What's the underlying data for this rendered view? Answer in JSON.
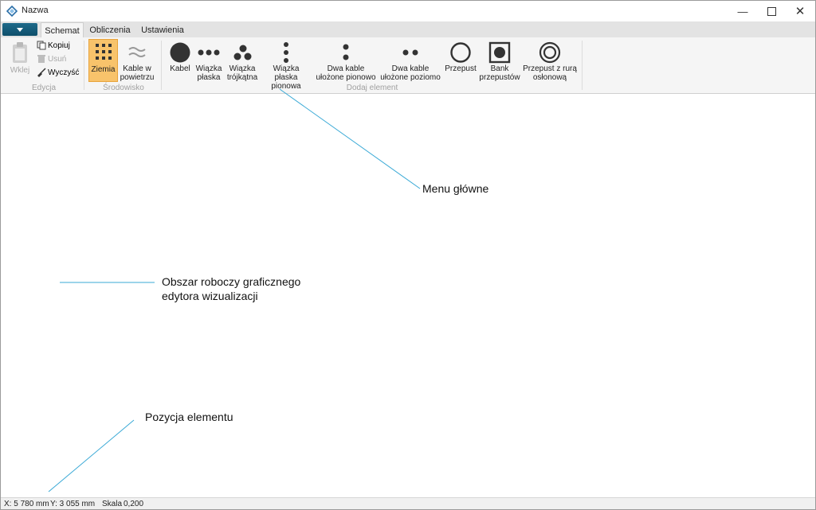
{
  "window": {
    "title": "Nazwa"
  },
  "tabs": [
    {
      "label": "Schemat",
      "active": true
    },
    {
      "label": "Obliczenia",
      "active": false
    },
    {
      "label": "Ustawienia",
      "active": false
    }
  ],
  "ribbon": {
    "edycja": {
      "label": "Edycja",
      "paste": "Wklej",
      "copy": "Kopiuj",
      "delete": "Usuń",
      "clear": "Wyczyść"
    },
    "srodowisko": {
      "label": "Środowisko",
      "ground": "Ziemia",
      "air_1": "Kable w",
      "air_2": "powietrzu"
    },
    "dodaj": {
      "label": "Dodaj element",
      "items": [
        {
          "l1": "Kabel",
          "l2": ""
        },
        {
          "l1": "Wiązka",
          "l2": "płaska"
        },
        {
          "l1": "Wiązka",
          "l2": "trójkątna"
        },
        {
          "l1": "Wiązka płaska",
          "l2": "pionowa"
        },
        {
          "l1": "Dwa kable",
          "l2": "ułożone pionowo"
        },
        {
          "l1": "Dwa kable",
          "l2": "ułożone poziomo"
        },
        {
          "l1": "Przepust",
          "l2": ""
        },
        {
          "l1": "Bank",
          "l2": "przepustów"
        },
        {
          "l1": "Przepust z rurą",
          "l2": "osłonową"
        }
      ]
    }
  },
  "annotations": {
    "menu": "Menu główne",
    "workspace_1": "Obszar roboczy graficznego",
    "workspace_2": "edytora wizualizacji",
    "position": "Pozycja elementu"
  },
  "status": {
    "x": "X:  5 780 mm",
    "y": "Y: 3 055 mm",
    "scale_label": "Skala",
    "scale_value": "0,200"
  },
  "colors": {
    "accent": "#1f6b8a",
    "active": "#f8c36b",
    "annotation_line": "#39a9d6"
  }
}
